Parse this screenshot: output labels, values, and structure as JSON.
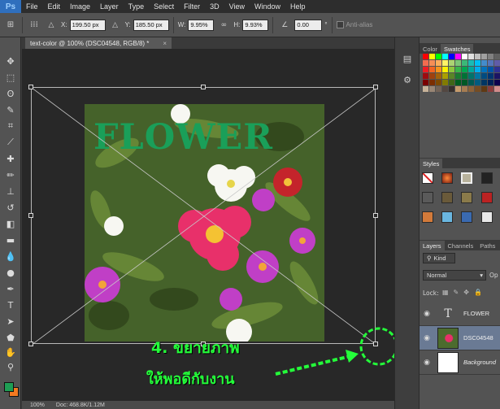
{
  "app": {
    "logo": "Ps"
  },
  "menu": [
    "File",
    "Edit",
    "Image",
    "Layer",
    "Type",
    "Select",
    "Filter",
    "3D",
    "View",
    "Window",
    "Help"
  ],
  "options": {
    "x_label": "X:",
    "x_value": "199.50 px",
    "y_label": "Y:",
    "y_value": "185.50 px",
    "w_label": "W:",
    "w_value": "9.95%",
    "h_label": "H:",
    "h_value": "9.93%",
    "angle_value": "0.00",
    "angle_unit": "°",
    "antialias_label": "Anti-alias"
  },
  "document": {
    "tab_title": "text-color @ 100% (DSC04548, RGB/8) *",
    "tab_close": "×",
    "canvas_text": "FLOWER"
  },
  "annotation": {
    "line1": "4. ขยายภาพ",
    "line2": "ให้พอดีกับงาน",
    "color": "#24ff3a"
  },
  "status": {
    "zoom": "100%",
    "doc": "Doc: 468.8K/1.12M"
  },
  "panels": {
    "color_tab": "Color",
    "swatches_tab": "Swatches",
    "styles_tab": "Styles",
    "layers_tab": "Layers",
    "channels_tab": "Channels",
    "paths_tab": "Paths",
    "kind_label": "Kind",
    "blend_mode": "Normal",
    "opacity_label": "Op",
    "lock_label": "Lock:"
  },
  "layers": [
    {
      "name": "FLOWER",
      "type": "text",
      "thumb": "T"
    },
    {
      "name": "DSC04548",
      "type": "image"
    },
    {
      "name": "Background",
      "type": "background"
    }
  ],
  "colors": {
    "fg": "#1e9e54",
    "bg": "#f47a20",
    "text_green": "#1a9f59"
  }
}
